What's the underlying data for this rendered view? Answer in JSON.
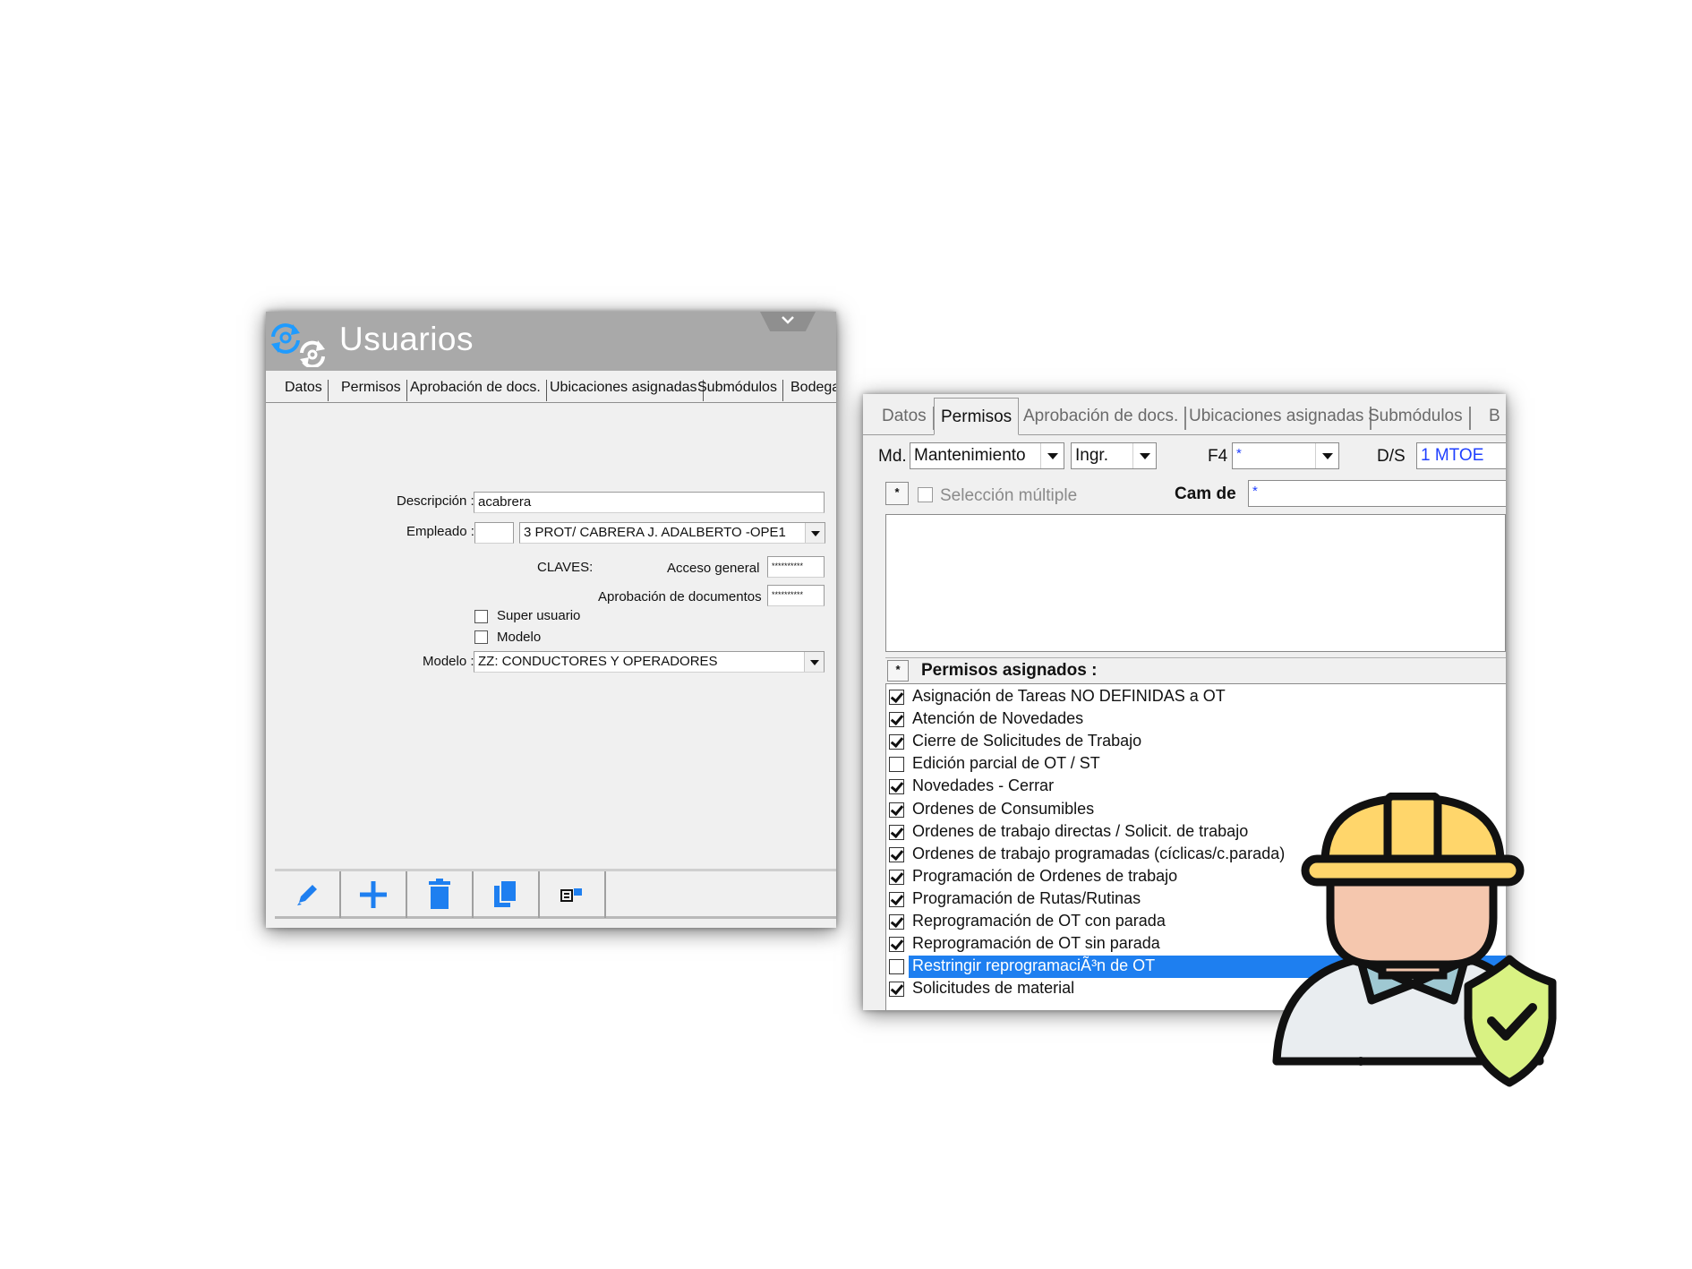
{
  "win1": {
    "title": "Usuarios",
    "tabs": [
      "Datos",
      "Permisos",
      "Aprobación de docs.",
      "Ubicaciones asignadas",
      "Submódulos",
      "Bodega"
    ],
    "form": {
      "descripcion_label": "Descripción :",
      "descripcion_value": "acabrera",
      "empleado_label": "Empleado :",
      "empleado_code": "",
      "empleado_value": "3 PROT/  CABRERA J. ADALBERTO     -OPE1",
      "claves_label": "CLAVES:",
      "acceso_general_label": "Acceso general",
      "acceso_general_value": "**********",
      "aprobacion_label": "Aprobación de documentos",
      "aprobacion_value": "**********",
      "super_usuario_label": "Super usuario",
      "super_usuario_checked": false,
      "modelo_check_label": "Modelo",
      "modelo_checked": false,
      "modelo_label": "Modelo :",
      "modelo_value": "ZZ: CONDUCTORES Y OPERADORES"
    },
    "toolbar": [
      "edit-icon",
      "add-icon",
      "delete-icon",
      "copy-icon",
      "assign-icon"
    ]
  },
  "win2": {
    "tabs": [
      "Datos",
      "Permisos",
      "Aprobación de docs.",
      "Ubicaciones asignadas",
      "Submódulos",
      "B"
    ],
    "active_tab": "Permisos",
    "md_label": "Md.",
    "md_value": "Mantenimiento",
    "ingr_value": "Ingr.",
    "f4_label": "F4",
    "f4_value": "*",
    "ds_label": "D/S",
    "ds_value": "1 MTOE",
    "mini_box_label": "*",
    "seleccion_multiple_label": "Selección múltiple",
    "cam_de_label": "Cam de",
    "cam_de_value": "*",
    "permisos_header": "Permisos asignados :",
    "permisos": [
      {
        "label": "Asignación de Tareas NO DEFINIDAS a OT",
        "checked": true
      },
      {
        "label": "Atención de Novedades",
        "checked": true
      },
      {
        "label": "Cierre de Solicitudes de Trabajo",
        "checked": true
      },
      {
        "label": "Edición parcial de OT / ST",
        "checked": false
      },
      {
        "label": "Novedades - Cerrar",
        "checked": true
      },
      {
        "label": "Ordenes de Consumibles",
        "checked": true
      },
      {
        "label": "Ordenes de trabajo directas / Solicit. de trabajo",
        "checked": true
      },
      {
        "label": "Ordenes de trabajo programadas (cíclicas/c.parada)",
        "checked": true
      },
      {
        "label": "Programación de Ordenes de trabajo",
        "checked": true
      },
      {
        "label": "Programación de Rutas/Rutinas",
        "checked": true
      },
      {
        "label": "Reprogramación de OT con parada",
        "checked": true
      },
      {
        "label": "Reprogramación de OT sin parada",
        "checked": true
      },
      {
        "label": "Restringir reprogramaciÃ³n de OT",
        "checked": false,
        "selected": true
      },
      {
        "label": "Solicitudes de material",
        "checked": true
      }
    ]
  },
  "colors": {
    "titlebar": "#a9a9a9",
    "selection": "#1e7ff0",
    "helmet": "#ffd66b",
    "shield": "#d9f283"
  }
}
